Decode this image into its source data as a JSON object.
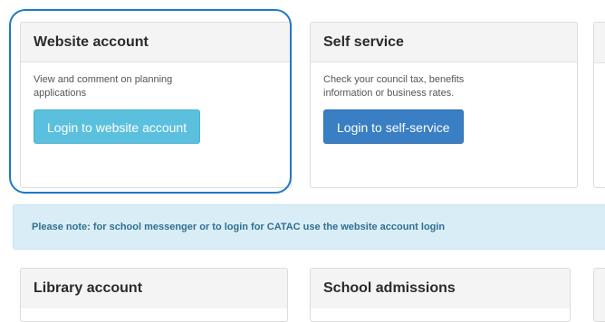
{
  "panels": [
    {
      "title": "Website account",
      "text": "View and comment on planning applications",
      "button": "Login to website account"
    },
    {
      "title": "Self service",
      "text": "Check your council tax, benefits information or business rates.",
      "button": "Login to self-service"
    }
  ],
  "notice": "Please note: for school messenger or to login for CATAC use the website account login",
  "bottom_panels": [
    {
      "title": "Library account"
    },
    {
      "title": "School admissions"
    }
  ],
  "colors": {
    "button_light": "#5bc0de",
    "button_dark": "#3a7ec4",
    "highlight_ring": "#1e78c8",
    "notice_bg": "#d9edf7",
    "notice_text": "#31708f"
  }
}
